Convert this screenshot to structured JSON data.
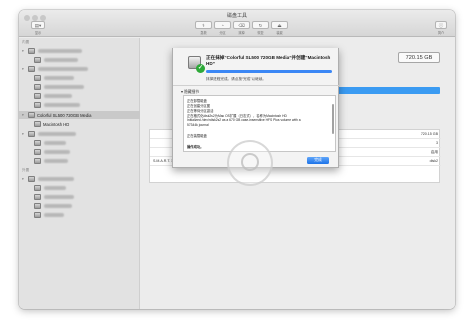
{
  "window": {
    "title": "磁盘工具"
  },
  "toolbar": {
    "view_label": "显示",
    "buttons": [
      {
        "label": "急救",
        "icon": "stethoscope-icon"
      },
      {
        "label": "分区",
        "icon": "pie-icon"
      },
      {
        "label": "抹掉",
        "icon": "eraser-icon"
      },
      {
        "label": "恢复",
        "icon": "restore-icon"
      },
      {
        "label": "装载",
        "icon": "mount-icon"
      },
      {
        "label": "简介",
        "icon": "info-icon"
      }
    ]
  },
  "sidebar": {
    "section_internal": "内置",
    "section_external": "外置",
    "selected_disk": "Colorful SL500 720GB Media",
    "selected_volume": "Macintosh HD"
  },
  "main": {
    "capacity": "720.15 GB",
    "info_rows": [
      {
        "key": "",
        "value": "720.15 GB",
        "key2": "",
        "value2": ""
      },
      {
        "key": "",
        "value": "3",
        "key2": "",
        "value2": ""
      },
      {
        "key": "",
        "value": "启用",
        "key2": "",
        "value2": ""
      },
      {
        "key": "S.M.A.R.T. 状态:",
        "value": "disk2",
        "key2": "已验证",
        "value2": "设备:"
      }
    ]
  },
  "sheet": {
    "title": "正在抹掉“Colorful SL500 720GB Media”并创建“Macintosh HD”",
    "progress": 1.0,
    "subtitle": "抹掉进程完成。请点按“完成”以继续。",
    "details_label": "隐藏细节",
    "log": [
      "正在卸载磁盘",
      "正在创建分区图",
      "正在等待分区激活",
      "正在格式化disk2s2为Mac OS扩展（日志式），名称为Macintosh HD",
      "Initialized /dev/rdisk2s2 as a 670 GB case-insensitive HFS Plus volume with a",
      "57344k journal",
      "",
      "正在装载磁盘",
      "",
      "操作成功。"
    ],
    "done_label": "完成"
  },
  "colors": {
    "accent": "#3b87f5",
    "success": "#2da938",
    "usage": "#3b9bf2"
  }
}
